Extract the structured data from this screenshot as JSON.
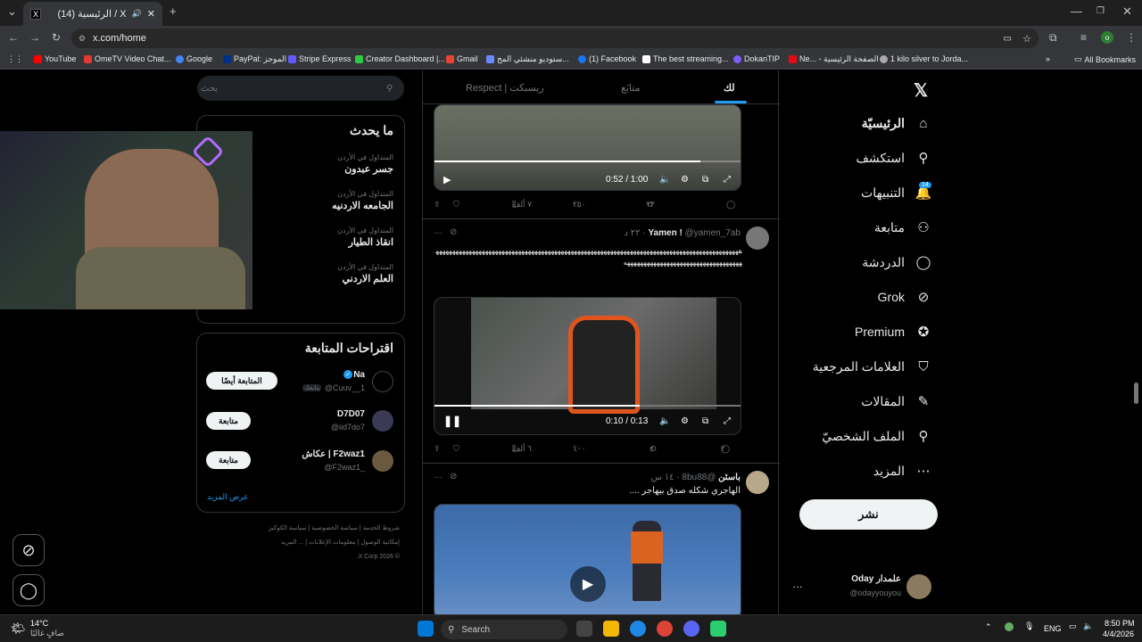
{
  "browser": {
    "tab_title": "(14) الرئيسية / X",
    "url": "x.com/home",
    "bookmarks": [
      "YouTube",
      "OmeTV Video Chat...",
      "Google",
      "PayPal: الموجز",
      "Stripe Express",
      "Creator Dashboard |...",
      "Gmail",
      "ستوديو منشئي المح...",
      "(1) Facebook",
      "The best streaming...",
      "DokanTIP",
      "Ne... - الصفحة الرئيسية",
      "1 kilo silver to Jorda..."
    ],
    "all_bookmarks": "All Bookmarks"
  },
  "nav": {
    "home": "الرئيسيّة",
    "explore": "استكشف",
    "notifications": "التنبيهات",
    "notifications_count": "14",
    "follow": "متابعة",
    "chat": "الدردشة",
    "grok": "Grok",
    "premium": "Premium",
    "bookmarks": "العلامات المرجعية",
    "articles": "المقالات",
    "profile": "الملف الشخصيّ",
    "more": "المزيد",
    "post": "نشر"
  },
  "account": {
    "name": "Oday علمدار",
    "handle": "@odayyouyou"
  },
  "timeline": {
    "tabs": [
      "لك",
      "متابَع",
      "Respect | ريسبكت"
    ],
    "post1": {
      "time": "0:52 / 1:00",
      "replies": "",
      "reposts": "١٣",
      "likes": "٢٥٠",
      "views": "٧ ألف"
    },
    "post2": {
      "name": "Yamen !",
      "handle": "@yamen_7ab",
      "age": "٢٢ د",
      "text": "ههههههههههههههههههههههههههههههههههههههههههههههههههههههههههههههههههههههههههههههههههههههههههههههههههههههههههههههههههههههههههههههههه",
      "time": "0:10 / 0:13",
      "replies": "٢",
      "reposts": "٤",
      "likes": "١٠٠",
      "views": "٦ ألف"
    },
    "post3": {
      "name": "باسئن",
      "handle": "@8bu88",
      "age": "١٤ س",
      "text": "الهاجري شكله صدق بيهاجر ...."
    }
  },
  "sidebar": {
    "search_placeholder": "بحث",
    "trends_title": "ما يحدث",
    "trends": [
      {
        "category": "المتداول في الأردن",
        "name": "جسر عبدون"
      },
      {
        "category": "المتداول في الأردن",
        "name": "الجامعه الاردنيه"
      },
      {
        "category": "المتداول في الأردن",
        "name": "انقاذ الطيار"
      },
      {
        "category": "المتداول في الأردن",
        "name": "العلم الاردني"
      }
    ],
    "who_to_follow_title": "اقتراحات المتابعة",
    "follow_suggestions": [
      {
        "name": "Na",
        "handle": "@Cuuv__1",
        "button": "المتابعة أيضًا",
        "tag": "يتابعك"
      },
      {
        "name": "D7D07",
        "handle": "@iid7do7",
        "button": "متابعة"
      },
      {
        "name": "عكاش | F2waz1",
        "handle": "@F2waz1_",
        "button": "متابعة"
      }
    ],
    "show_more": "عرض المزيد",
    "footer": [
      "شروط الخدمة",
      "سياسة الخصوصية",
      "سياسة الكوكيز",
      "إمكانية الوصول",
      "معلومات الإعلانات",
      "... المزيد",
      "© 2026 X Corp."
    ]
  },
  "taskbar": {
    "weather_temp": "14°C",
    "weather_desc": "صافٍ غالبًا",
    "search": "Search",
    "lang": "ENG",
    "time": "8:50 PM",
    "date": "4/4/2026"
  }
}
